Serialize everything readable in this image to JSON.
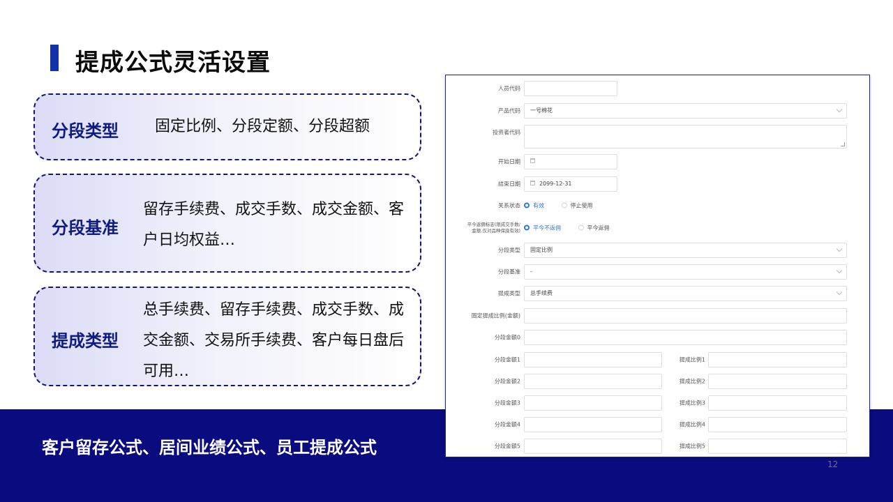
{
  "slide": {
    "title": "提成公式灵活设置",
    "page_number": "12",
    "footer_text": "客户留存公式、居间业绩公式、员工提成公式"
  },
  "cards": [
    {
      "label": "分段类型",
      "text": "固定比例、分段定额、分段超额"
    },
    {
      "label": "分段基准",
      "text": "留存手续费、成交手数、成交金额、客户日均权益…"
    },
    {
      "label": "提成类型",
      "text": "总手续费、留存手续费、成交手数、成交金额、交易所手续费、客户每日盘后可用…"
    }
  ],
  "form": {
    "staff_code_label": "人员代码",
    "staff_code_value": "",
    "product_code_label": "产品代码",
    "product_code_value": "一号棉花",
    "investor_code_label": "投资者代码",
    "investor_code_value": "",
    "start_date_label": "开始日期",
    "start_date_value": "",
    "end_date_label": "结束日期",
    "end_date_value": "2099-12-31",
    "relation_status_label": "关系状态",
    "relation_status_options": [
      "有效",
      "停止使用"
    ],
    "relation_status_selected": "有效",
    "rebate_flag_label_line1": "平今返佣标志(限成交手数/",
    "rebate_flag_label_line2": "金额,仅对品种保底有效)",
    "rebate_flag_options": [
      "平今不返佣",
      "平今返佣"
    ],
    "rebate_flag_selected": "平今不返佣",
    "segment_type_label": "分段类型",
    "segment_type_value": "固定比例",
    "segment_basis_label": "分段基准",
    "segment_basis_value": "-",
    "commission_type_label": "提成类型",
    "commission_type_value": "总手续费",
    "fixed_ratio_label": "固定提成比例(金额)",
    "fixed_ratio_value": "",
    "segment_amount_0_label": "分段金额0",
    "segment_amount_0_value": "",
    "segment_rows": [
      {
        "amount_label": "分段金额1",
        "amount_value": "",
        "ratio_label": "提成比例1",
        "ratio_value": ""
      },
      {
        "amount_label": "分段金额2",
        "amount_value": "",
        "ratio_label": "提成比例2",
        "ratio_value": ""
      },
      {
        "amount_label": "分段金额3",
        "amount_value": "",
        "ratio_label": "提成比例3",
        "ratio_value": ""
      },
      {
        "amount_label": "分段金额4",
        "amount_value": "",
        "ratio_label": "提成比例4",
        "ratio_value": ""
      },
      {
        "amount_label": "分段金额5",
        "amount_value": "",
        "ratio_label": "提成比例5",
        "ratio_value": ""
      }
    ]
  },
  "colors": {
    "accent_bar": "#1432a8",
    "footer_bg": "#0b0b80",
    "card_border": "#12127a",
    "card_label": "#0d1b80",
    "radio_active": "#2d74e0"
  }
}
